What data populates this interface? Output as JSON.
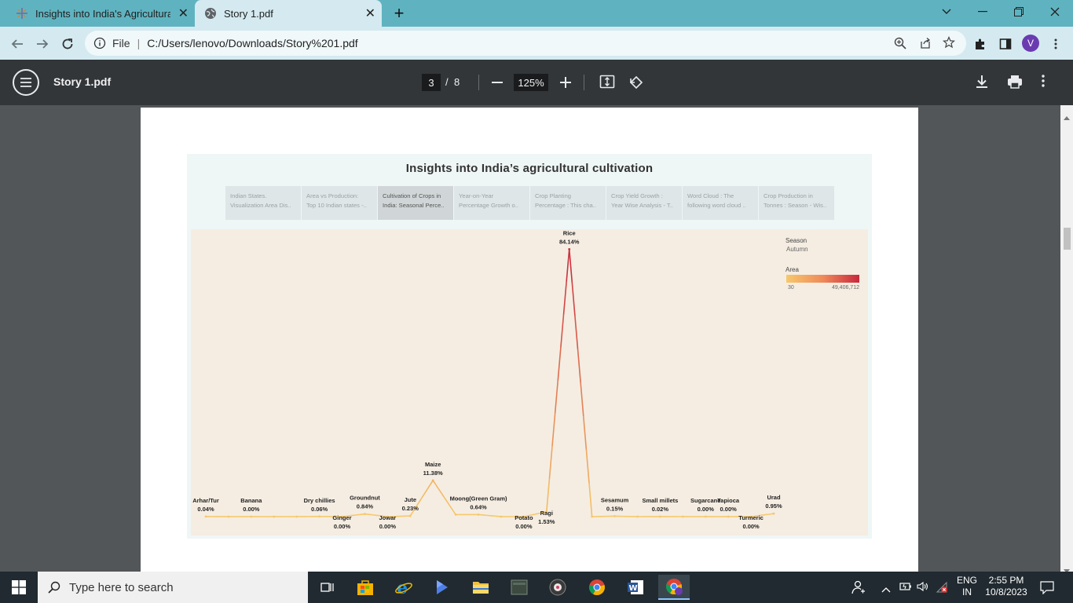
{
  "browser": {
    "tabs": [
      {
        "label": "Insights into India's Agricultural",
        "icon": "tableau-icon",
        "active": false
      },
      {
        "label": "Story 1.pdf",
        "icon": "globe-icon",
        "active": true
      }
    ],
    "address": {
      "prefix": "File",
      "url": "C:/Users/lenovo/Downloads/Story%201.pdf"
    },
    "profile_initial": "V"
  },
  "pdf_toolbar": {
    "title": "Story 1.pdf",
    "current_page": "3",
    "page_sep": "/",
    "total_pages": "8",
    "zoom": "125%"
  },
  "dashboard": {
    "title": "Insights into India’s agricultural cultivation",
    "story_tabs": [
      {
        "line1": "Indian States.",
        "line2": "Visualization Area Dis..",
        "active": false
      },
      {
        "line1": "Area vs Production:",
        "line2": "Top 10 Indian states -..",
        "active": false
      },
      {
        "line1": "Cultivation of Crops in",
        "line2": "India: Seasonal Perce..",
        "active": true
      },
      {
        "line1": "Year-on-Year",
        "line2": "Percentage Growth o..",
        "active": false
      },
      {
        "line1": "Crop Planting",
        "line2": "Percentage : This cha..",
        "active": false
      },
      {
        "line1": "Crop Yield Growth :",
        "line2": "Year Wise Analysis - T..",
        "active": false
      },
      {
        "line1": "Word Cloud : The",
        "line2": "following word cloud ..",
        "active": false
      },
      {
        "line1": "Crop Production in",
        "line2": "Tonnes : Season - Wis..",
        "active": false
      }
    ],
    "legend": {
      "season_title": "Season",
      "season_value": "Autumn",
      "area_title": "Area",
      "area_min": "30",
      "area_max": "49,406,712",
      "color_low": "#f7c86a",
      "color_high": "#c8283c"
    }
  },
  "chart_data": {
    "type": "line",
    "title": "",
    "xlabel": "",
    "ylabel": "",
    "color_measure": "Area",
    "ylim": [
      0,
      100
    ],
    "points": [
      {
        "name": "Arhar/Tur",
        "value": 0.04,
        "label": "0.04%",
        "pos": "above"
      },
      {
        "name": "",
        "value": 0.0,
        "label": "",
        "pos": "none"
      },
      {
        "name": "Banana",
        "value": 0.0,
        "label": "0.00%",
        "pos": "above"
      },
      {
        "name": "",
        "value": 0.0,
        "label": "",
        "pos": "none"
      },
      {
        "name": "",
        "value": 0.0,
        "label": "",
        "pos": "none"
      },
      {
        "name": "Dry chillies",
        "value": 0.06,
        "label": "0.06%",
        "pos": "above"
      },
      {
        "name": "Ginger",
        "value": 0.0,
        "label": "0.00%",
        "pos": "below"
      },
      {
        "name": "Groundnut",
        "value": 0.84,
        "label": "0.84%",
        "pos": "above"
      },
      {
        "name": "Jowar",
        "value": 0.0,
        "label": "0.00%",
        "pos": "below"
      },
      {
        "name": "Jute",
        "value": 0.23,
        "label": "0.23%",
        "pos": "above"
      },
      {
        "name": "Maize",
        "value": 11.38,
        "label": "11.38%",
        "pos": "above"
      },
      {
        "name": "",
        "value": 0.64,
        "label": "",
        "pos": "none"
      },
      {
        "name": "Moong(Green Gram)",
        "value": 0.64,
        "label": "0.64%",
        "pos": "above"
      },
      {
        "name": "",
        "value": 0.0,
        "label": "",
        "pos": "none"
      },
      {
        "name": "Potato",
        "value": 0.0,
        "label": "0.00%",
        "pos": "below"
      },
      {
        "name": "Ragi",
        "value": 1.53,
        "label": "1.53%",
        "pos": "below"
      },
      {
        "name": "Rice",
        "value": 84.14,
        "label": "84.14%",
        "pos": "above"
      },
      {
        "name": "",
        "value": 0.0,
        "label": "",
        "pos": "none"
      },
      {
        "name": "Sesamum",
        "value": 0.15,
        "label": "0.15%",
        "pos": "above"
      },
      {
        "name": "",
        "value": 0.0,
        "label": "",
        "pos": "none"
      },
      {
        "name": "Small millets",
        "value": 0.02,
        "label": "0.02%",
        "pos": "above"
      },
      {
        "name": "",
        "value": 0.0,
        "label": "",
        "pos": "none"
      },
      {
        "name": "Sugarcane",
        "value": 0.0,
        "label": "0.00%",
        "pos": "above"
      },
      {
        "name": "Tapioca",
        "value": 0.0,
        "label": "0.00%",
        "pos": "above"
      },
      {
        "name": "Turmeric",
        "value": 0.0,
        "label": "0.00%",
        "pos": "below"
      },
      {
        "name": "Urad",
        "value": 0.95,
        "label": "0.95%",
        "pos": "above"
      }
    ]
  },
  "taskbar": {
    "search_placeholder": "Type here to search",
    "lang1": "ENG",
    "lang2": "IN",
    "time": "2:55 PM",
    "date": "10/8/2023"
  }
}
